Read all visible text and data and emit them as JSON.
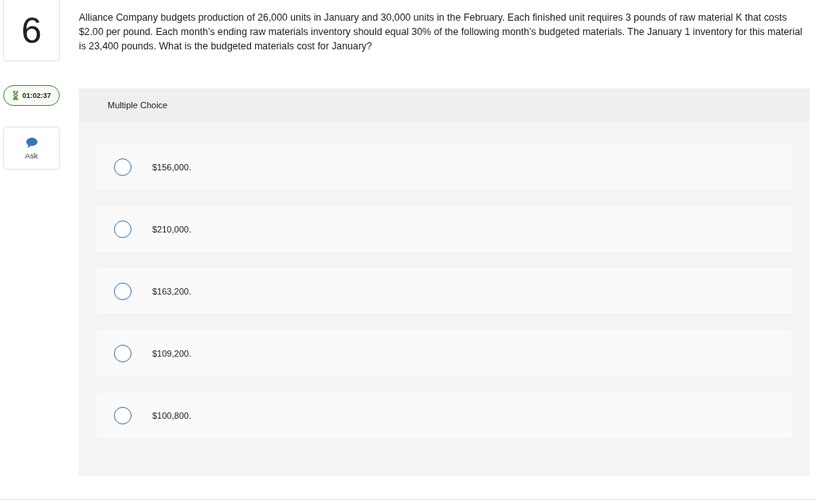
{
  "question_number": "6",
  "timer": "01:02:37",
  "ask": {
    "label": "Ask"
  },
  "question": "Alliance Company budgets production of 26,000 units in January and 30,000 units in the February. Each finished unit requires 3 pounds of raw material K that costs $2.00 per pound. Each month’s ending raw materials inventory should equal 30% of the following month’s budgeted materials. The January 1 inventory for this material is 23,400 pounds. What is the budgeted materials cost for January?",
  "answer_type": "Multiple Choice",
  "options": [
    {
      "label": "$156,000.",
      "selected": false
    },
    {
      "label": "$210,000.",
      "selected": false
    },
    {
      "label": "$163,200.",
      "selected": false
    },
    {
      "label": "$109,200.",
      "selected": false
    },
    {
      "label": "$100,800.",
      "selected": false
    }
  ]
}
